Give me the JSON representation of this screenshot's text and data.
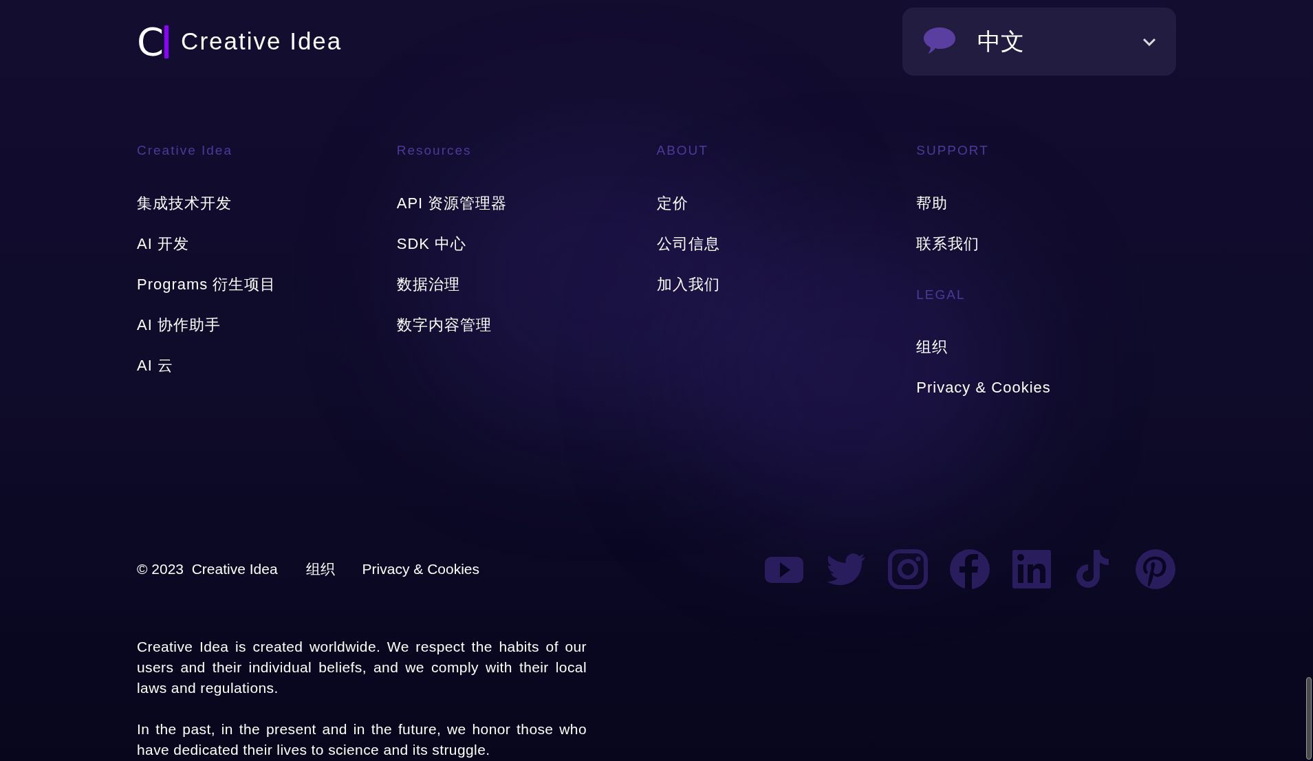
{
  "logo": {
    "mark_letter": "C",
    "name": "Creative Idea"
  },
  "language_selector": {
    "value": "中文",
    "expanded": false
  },
  "columns": [
    {
      "heading": "Creative Idea",
      "links": [
        "集成技术开发",
        "AI 开发",
        "Programs 衍生项目",
        "AI 协作助手",
        "AI 云"
      ]
    },
    {
      "heading": "Resources",
      "links": [
        "API 资源管理器",
        "SDK 中心",
        "数据治理",
        "数字内容管理"
      ]
    },
    {
      "heading": "ABOUT",
      "links": [
        "定价",
        "公司信息",
        "加入我们"
      ]
    },
    {
      "heading": "SUPPORT",
      "links": [
        "帮助",
        "联系我们"
      ],
      "subsection": {
        "heading": "LEGAL",
        "links": [
          "组织",
          "Privacy & Cookies"
        ]
      }
    }
  ],
  "copyright": "© 2023  Creative Idea",
  "bottom_links": [
    "组织",
    "Privacy & Cookies"
  ],
  "social": [
    {
      "kind": "youtube"
    },
    {
      "kind": "twitter"
    },
    {
      "kind": "instagram"
    },
    {
      "kind": "facebook"
    },
    {
      "kind": "linkedin"
    },
    {
      "kind": "tiktok"
    },
    {
      "kind": "pinterest"
    }
  ],
  "paragraphs": [
    "Creative Idea is created worldwide. We respect the habits of our users and their individual beliefs, and we comply with their local laws and regulations.",
    "In the past, in the present and in the future, we honor those who have dedicated their lives to science and its struggle."
  ]
}
